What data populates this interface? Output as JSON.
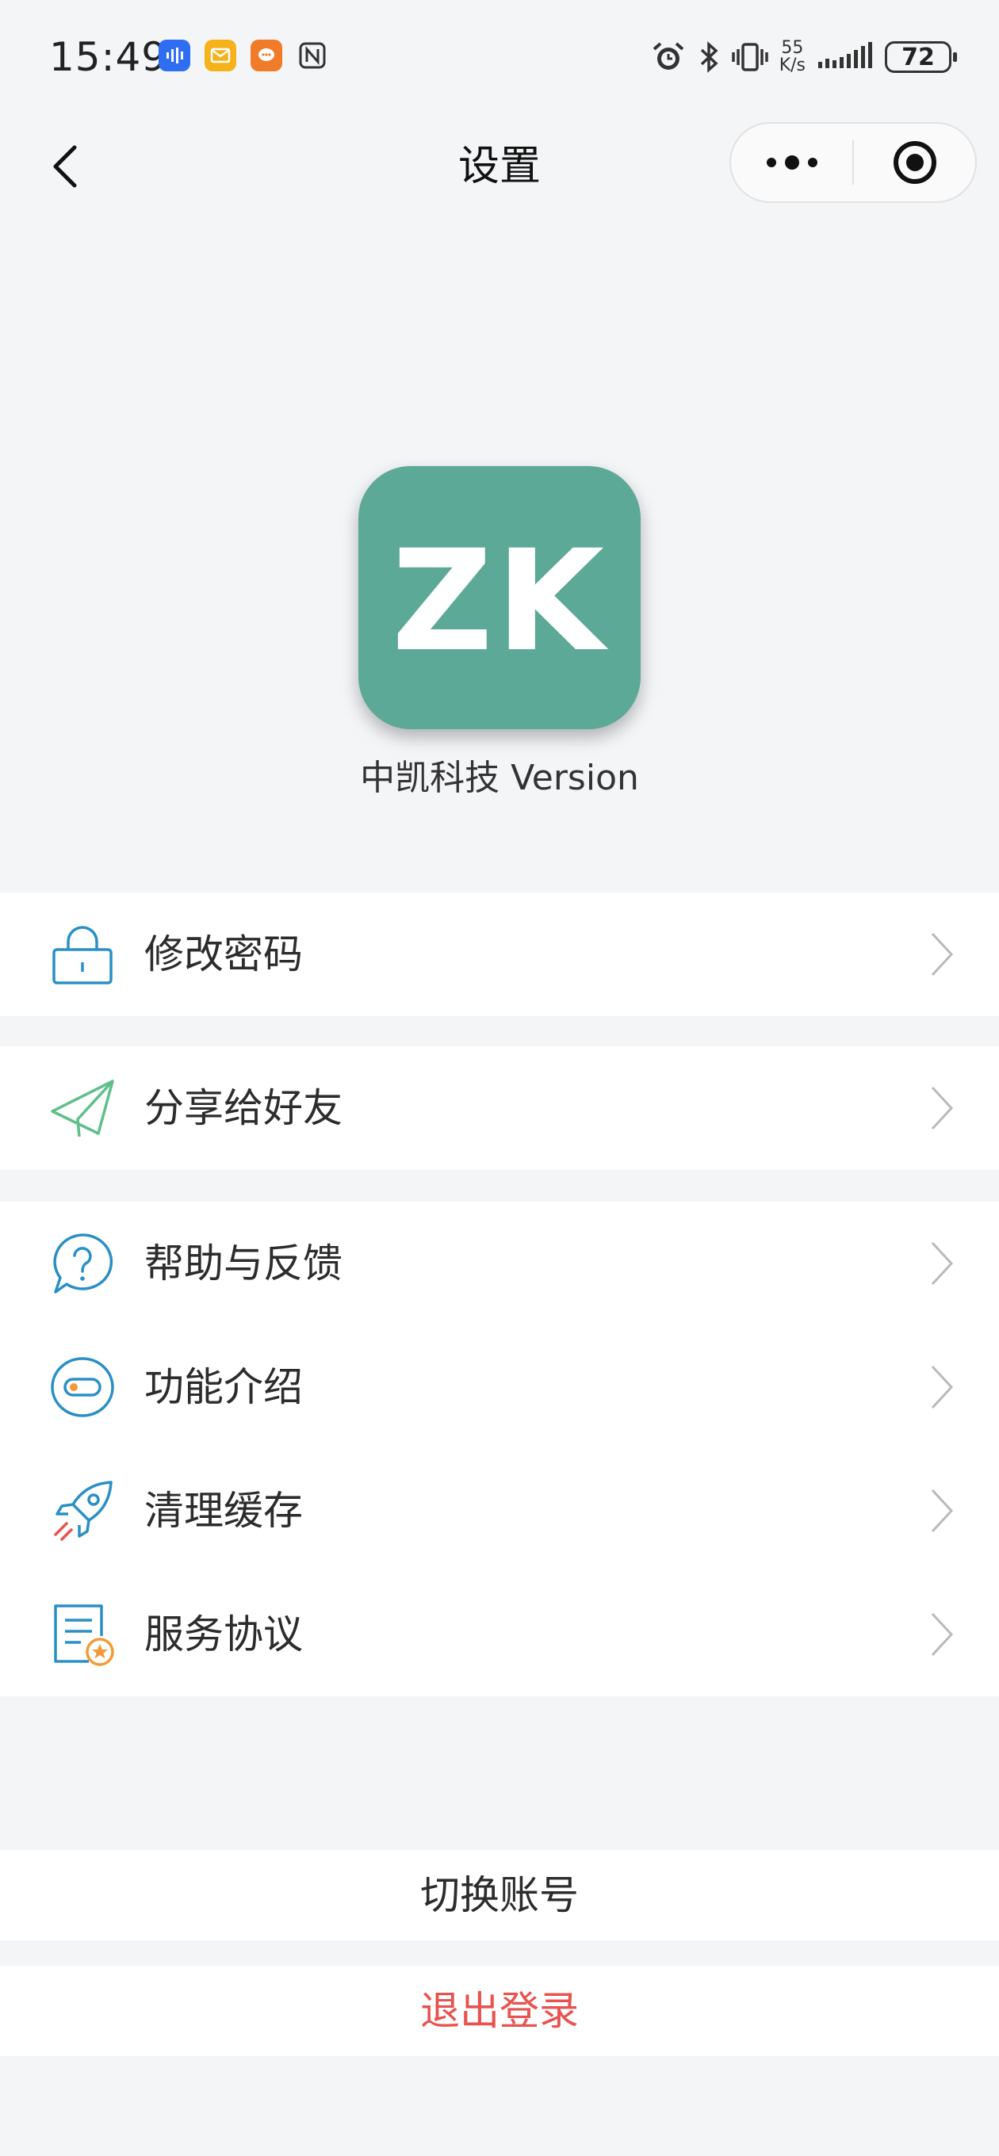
{
  "status_bar": {
    "time": "15:49",
    "net_speed_value": "55",
    "net_speed_unit": "K/s",
    "battery": "72"
  },
  "nav": {
    "title": "设置"
  },
  "app": {
    "logo_text": "ZK",
    "version_label": "中凯科技 Version",
    "logo_color": "#5ca997"
  },
  "menu": {
    "change_password": "修改密码",
    "share": "分享给好友",
    "help": "帮助与反馈",
    "features": "功能介绍",
    "clear_cache": "清理缓存",
    "agreement": "服务协议"
  },
  "actions": {
    "switch_account": "切换账号",
    "logout": "退出登录",
    "logout_color": "#e8534f"
  }
}
